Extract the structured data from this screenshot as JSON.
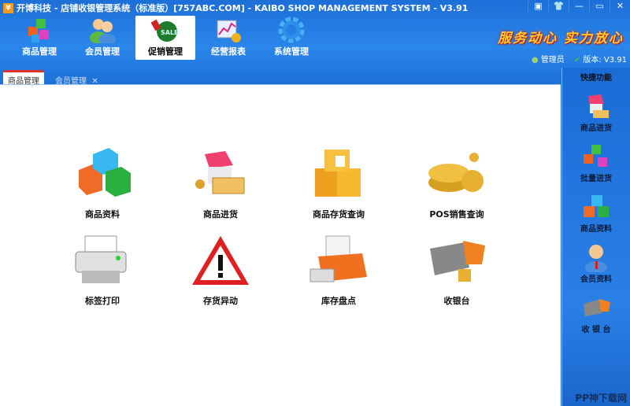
{
  "window": {
    "title": "开博科技 - 店铺收银管理系统（标准版）[757ABC.COM] - KAIBO SHOP MANAGEMENT SYSTEM - V3.91",
    "buttons": [
      "▣",
      "👕",
      "—",
      "▭",
      "✕"
    ]
  },
  "nav": [
    {
      "label": "商品管理"
    },
    {
      "label": "会员管理"
    },
    {
      "label": "促销管理",
      "active": true
    },
    {
      "label": "经营报表"
    },
    {
      "label": "系统管理"
    }
  ],
  "slogan": "服务动心 实力放心",
  "status": {
    "user": "管理员",
    "version": "版本: V3.91"
  },
  "tabs": [
    {
      "label": "商品管理",
      "active": true
    },
    {
      "label": "会员管理",
      "close": "✕"
    }
  ],
  "main_items": [
    "商品资料",
    "商品进货",
    "商品存货查询",
    "POS销售查询",
    "标签打印",
    "存货异动",
    "库存盘点",
    "收银台"
  ],
  "sidebar": {
    "title": "快捷功能",
    "items": [
      "商品进货",
      "批量进货",
      "商品资料",
      "会员资料",
      "收 银 台"
    ]
  },
  "watermark": "PP神下载网"
}
